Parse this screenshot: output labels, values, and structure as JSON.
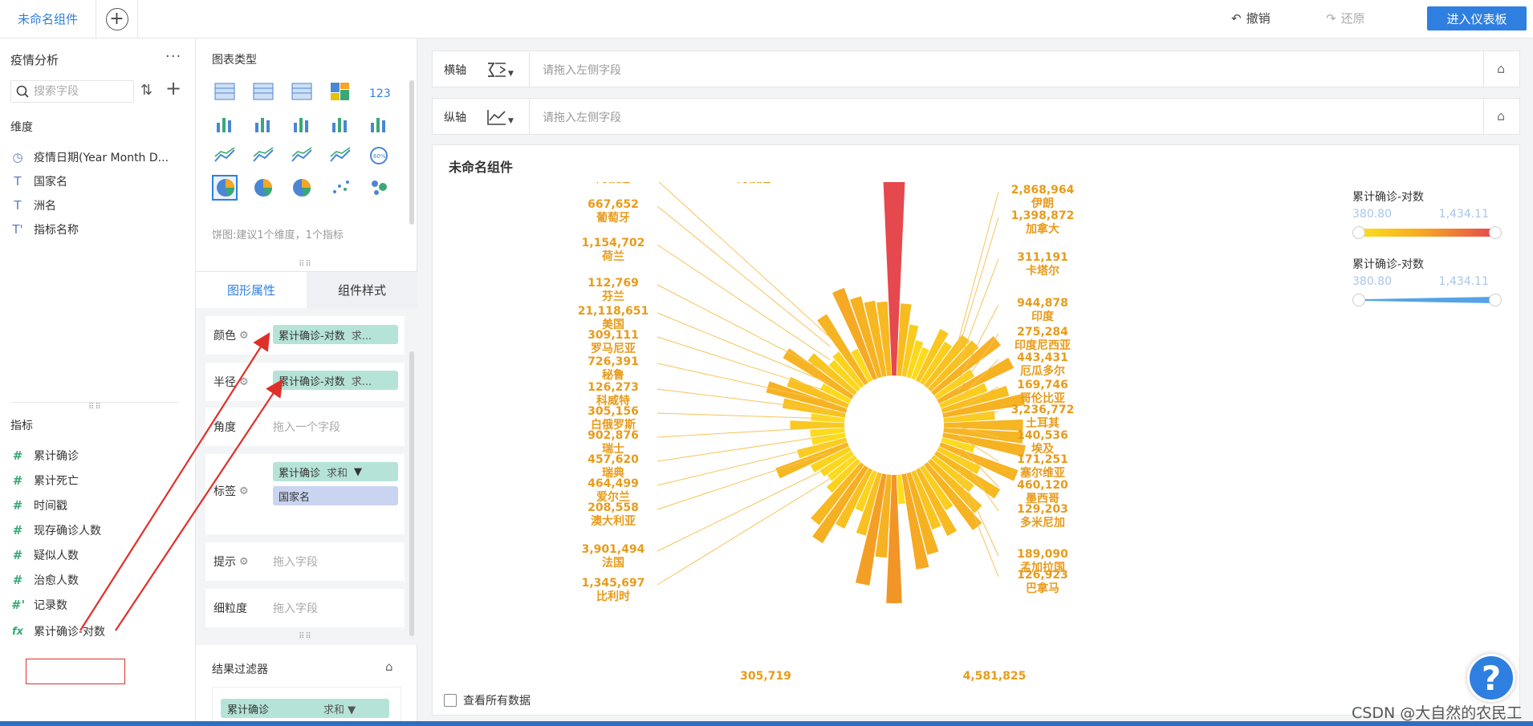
{
  "topbar": {
    "tab_label": "未命名组件",
    "undo_label": "撤销",
    "redo_label": "还原",
    "enter_dashboard_label": "进入仪表板"
  },
  "left_panel": {
    "dataset_title": "疫情分析",
    "search_placeholder": "搜索字段",
    "dimension_header": "维度",
    "dimensions": [
      {
        "icon": "clock-icon",
        "label": "疫情日期(Year Month D..."
      },
      {
        "icon": "text-type-icon",
        "label": "国家名"
      },
      {
        "icon": "text-type-icon",
        "label": "洲名"
      },
      {
        "icon": "text-type-icon",
        "label": "指标名称"
      }
    ],
    "measure_header": "指标",
    "measures": [
      {
        "icon": "hash-icon",
        "label": "累计确诊"
      },
      {
        "icon": "hash-icon",
        "label": "累计死亡"
      },
      {
        "icon": "hash-icon",
        "label": "时间戳"
      },
      {
        "icon": "hash-icon",
        "label": "现存确诊人数"
      },
      {
        "icon": "hash-icon",
        "label": "疑似人数"
      },
      {
        "icon": "hash-icon",
        "label": "治愈人数"
      },
      {
        "icon": "hash-icon",
        "label": "记录数"
      },
      {
        "icon": "fx-icon",
        "label": "累计确诊-对数"
      }
    ]
  },
  "middle_panel": {
    "chart_type_title": "图表类型",
    "chart_type_hint": "饼图:建议1个维度，1个指标",
    "tab_graph_props": "图形属性",
    "tab_component_style": "组件样式",
    "props": {
      "color_label": "颜色",
      "color_field": "累计确诊-对数",
      "color_agg": "求...",
      "radius_label": "半径",
      "radius_field": "累计确诊-对数",
      "radius_agg": "求...",
      "angle_label": "角度",
      "angle_placeholder": "拖入一个字段",
      "label_label": "标签",
      "label_field1": "累计确诊",
      "label_field1_agg": "求和",
      "label_field2": "国家名",
      "tooltip_label": "提示",
      "tooltip_placeholder": "拖入字段",
      "granularity_label": "细粒度",
      "granularity_placeholder": "拖入字段"
    },
    "result_filter_title": "结果过滤器",
    "filter_field": "累计确诊",
    "filter_agg": "求和"
  },
  "right_panel": {
    "x_axis_label": "横轴",
    "x_axis_placeholder": "请拖入左侧字段",
    "y_axis_label": "纵轴",
    "y_axis_placeholder": "请拖入左侧字段",
    "chart_title": "未命名组件",
    "legend1": {
      "title": "累计确诊-对数",
      "min": "380.80",
      "max": "1,434.11"
    },
    "legend2": {
      "title": "累计确诊-对数",
      "min": "380.80",
      "max": "1,434.11"
    },
    "view_all_label": "查看所有数据"
  },
  "help_label": "?",
  "watermark": "CSDN @大自然的农民工",
  "colors": {
    "accent": "#2f7fe0",
    "gradient_low": "#fde21c",
    "gradient_high": "#e5484d",
    "legend2": "#55a3e6"
  },
  "chart_data": {
    "type": "radial-bar",
    "series_field": "累计确诊-对数",
    "label_field": "累计确诊",
    "visible_labels": [
      {
        "value": "阿根廷",
        "country": ""
      },
      {
        "value": "2,868,964",
        "country": "伊朗"
      },
      {
        "value": "667,652",
        "country": "葡萄牙"
      },
      {
        "value": "1,398,872",
        "country": "加拿大"
      },
      {
        "value": "1,154,702",
        "country": "荷兰"
      },
      {
        "value": "311,191",
        "country": "卡塔尔"
      },
      {
        "value": "112,769",
        "country": "芬兰"
      },
      {
        "value": "21,118,651",
        "country": "美国"
      },
      {
        "value": "944,878",
        "country": "印度"
      },
      {
        "value": "309,111",
        "country": "罗马尼亚"
      },
      {
        "value": "275,284",
        "country": "印度尼西亚"
      },
      {
        "value": "726,391",
        "country": "秘鲁"
      },
      {
        "value": "443,431",
        "country": "厄瓜多尔"
      },
      {
        "value": "126,273",
        "country": "科威特"
      },
      {
        "value": "169,746",
        "country": "哥伦比亚"
      },
      {
        "value": "305,156",
        "country": "白俄罗斯"
      },
      {
        "value": "3,236,772",
        "country": "土耳其"
      },
      {
        "value": "902,876",
        "country": "瑞士"
      },
      {
        "value": "140,536",
        "country": "埃及"
      },
      {
        "value": "457,620",
        "country": "瑞典"
      },
      {
        "value": "171,251",
        "country": "塞尔维亚"
      },
      {
        "value": "464,499",
        "country": "爱尔兰"
      },
      {
        "value": "460,120",
        "country": "墨西哥"
      },
      {
        "value": "208,558",
        "country": "澳大利亚"
      },
      {
        "value": "129,203",
        "country": "多米尼加"
      },
      {
        "value": "3,901,494",
        "country": "法国"
      },
      {
        "value": "189,090",
        "country": "孟加拉国"
      },
      {
        "value": "1,345,697",
        "country": "比利时"
      },
      {
        "value": "126,923",
        "country": "巴拿马"
      },
      {
        "value": "305,719",
        "country": ""
      },
      {
        "value": "4,581,825",
        "country": ""
      }
    ]
  }
}
